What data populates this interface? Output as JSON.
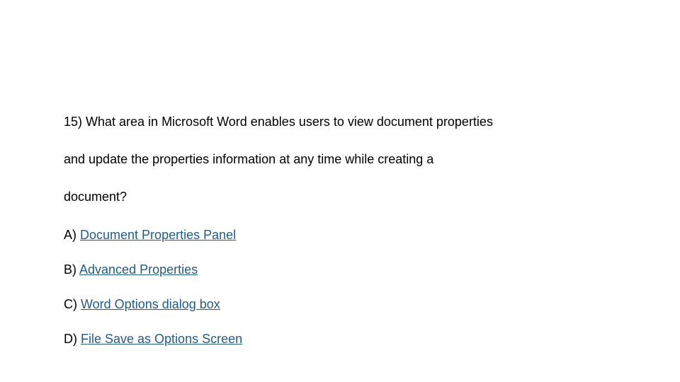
{
  "question": {
    "line1": "15) What area in Microsoft Word enables users to view document properties",
    "line2": "and update the properties information at any time while creating a",
    "line3": "document?"
  },
  "options": [
    {
      "prefix": "A) ",
      "label": "Document Properties Panel"
    },
    {
      "prefix": "B) ",
      "label": "Advanced Properties"
    },
    {
      "prefix": "C) ",
      "label": "Word Options dialog box"
    },
    {
      "prefix": "D) ",
      "label": "File Save as Options Screen"
    }
  ]
}
